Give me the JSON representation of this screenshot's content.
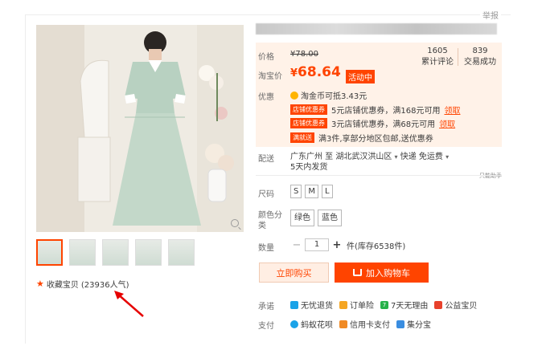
{
  "report_label": "举报",
  "gallery": {
    "thumb_count": 5,
    "favorite": {
      "label": "收藏宝贝",
      "count": "(23936人气)"
    }
  },
  "price": {
    "label_price": "价格",
    "original": "¥78.00",
    "label_tb": "淘宝价",
    "current_symbol": "¥",
    "current": "68.64",
    "promo_tag": "活动中",
    "reviews_count": "1605",
    "reviews_label": "累计评论",
    "sales_count": "839",
    "sales_label": "交易成功"
  },
  "offers": {
    "label": "优惠",
    "coin_text": "淘金币可抵3.43元",
    "coupons": [
      {
        "tag": "店铺优惠券",
        "text": "5元店铺优惠券，满168元可用",
        "action": "领取"
      },
      {
        "tag": "店铺优惠券",
        "text": "3元店铺优惠券，满68元可用",
        "action": "领取"
      }
    ],
    "bundle_tag": "满就送",
    "bundle_text": "满3件,享部分地区包邮,送优惠券"
  },
  "delivery": {
    "label": "配送",
    "line1": "广东广州 至 湖北武汉洪山区",
    "method": "快递 免运费",
    "line2": "5天内发货",
    "note": "只能助手"
  },
  "size": {
    "label": "尺码",
    "options": [
      "S",
      "M",
      "L"
    ]
  },
  "color": {
    "label": "颜色分类",
    "options": [
      "绿色",
      "蓝色"
    ]
  },
  "quantity": {
    "label": "数量",
    "value": "1",
    "stock": "件(库存6538件)"
  },
  "actions": {
    "buy": "立即购买",
    "cart": "加入购物车"
  },
  "promise": {
    "label": "承诺",
    "items": [
      "无忧退货",
      "订单险",
      "7天无理由",
      "公益宝贝"
    ],
    "colors": [
      "#1aa3e8",
      "#f5a623",
      "#27b24a",
      "#e8412c"
    ]
  },
  "payment": {
    "label": "支付",
    "items": [
      "蚂蚁花呗",
      "信用卡支付",
      "集分宝"
    ],
    "colors": [
      "#1aa3e8",
      "#f08a24",
      "#3a8de0"
    ]
  }
}
